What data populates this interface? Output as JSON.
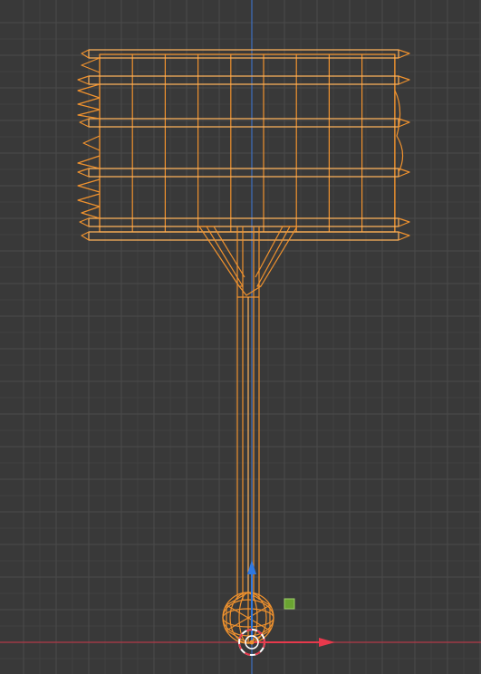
{
  "viewport": {
    "background": "#393939",
    "grid_minor_color": "#414141",
    "grid_major_color": "#4b4b4b",
    "x_axis_color": "#b33a47",
    "y_axis_color": "#3d6fbf",
    "selection_color": "#f0922e",
    "selection_highlight": "#ffb35c"
  },
  "gizmo": {
    "x_arrow_color": "#e8394c",
    "z_arrow_color": "#2f78e0",
    "scale_handle_color": "#6aa431",
    "pivot_icon": "3d-cursor-icon"
  },
  "object": {
    "type": "hammer-wireframe",
    "mode": "edit-selected"
  }
}
